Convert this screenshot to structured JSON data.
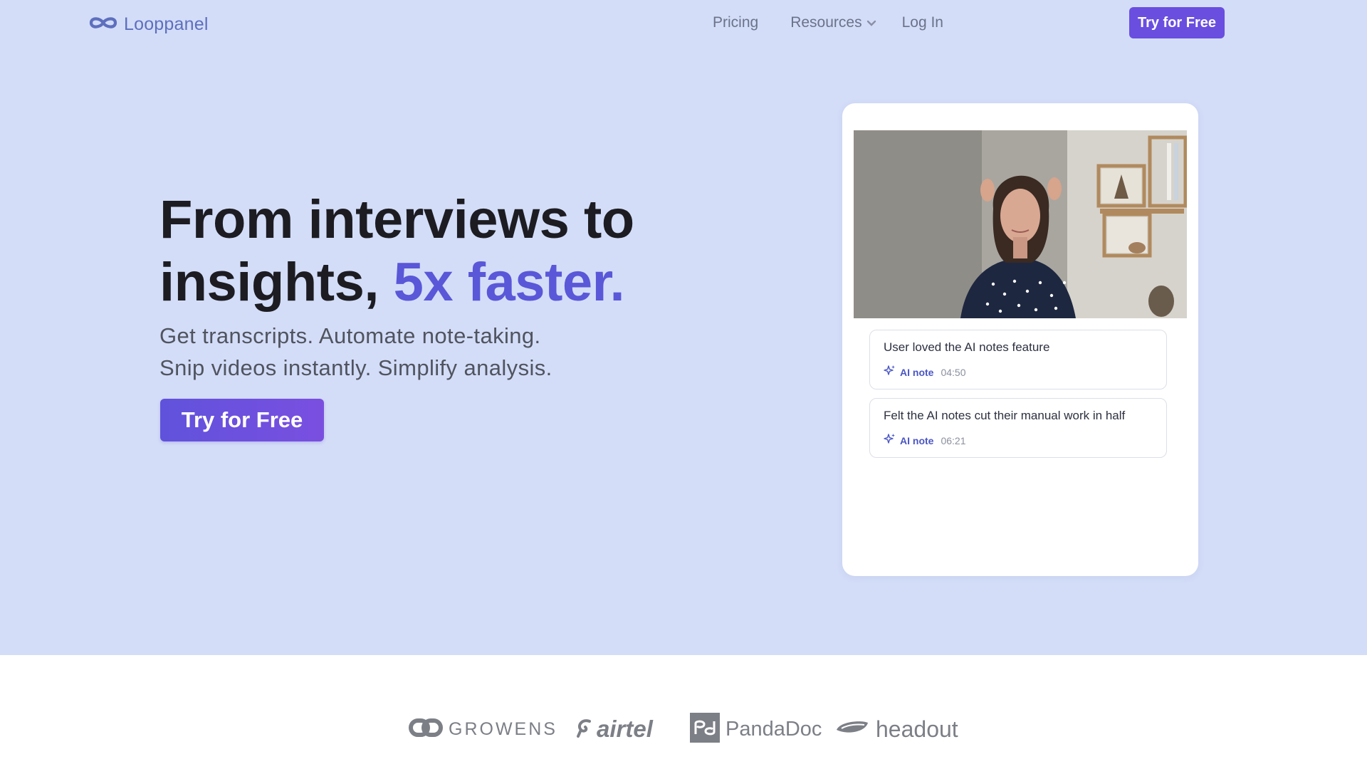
{
  "nav": {
    "logo": "Looppanel",
    "links": [
      "Pricing",
      "Resources",
      "Log In"
    ],
    "cta": "Try for Free"
  },
  "hero": {
    "headline_line1": "From interviews to",
    "headline_line2_prefix": "insights, ",
    "headline_accent": "5x faster.",
    "subline_1": "Get transcripts. Automate note-taking.",
    "subline_2": "Snip videos instantly. Simplify analysis.",
    "cta": "Try for Free"
  },
  "card": {
    "notes": [
      {
        "text": "User loved the AI notes feature",
        "tag": "AI note",
        "time": "04:50"
      },
      {
        "text": "Felt the AI notes cut their manual work in half",
        "tag": "AI note",
        "time": "06:21"
      }
    ]
  },
  "logos": {
    "growens": "GROWENS",
    "airtel": "airtel",
    "pandadoc": "PandaDoc",
    "headout": "headout"
  },
  "colors": {
    "hero_bg": "#d3ddf8",
    "accent": "#5a57d8",
    "button": "#6a4ee0",
    "heading": "#1c1c22"
  },
  "icons": [
    "infinity-logo-icon",
    "chevron-down-icon",
    "sparkle-icon"
  ]
}
